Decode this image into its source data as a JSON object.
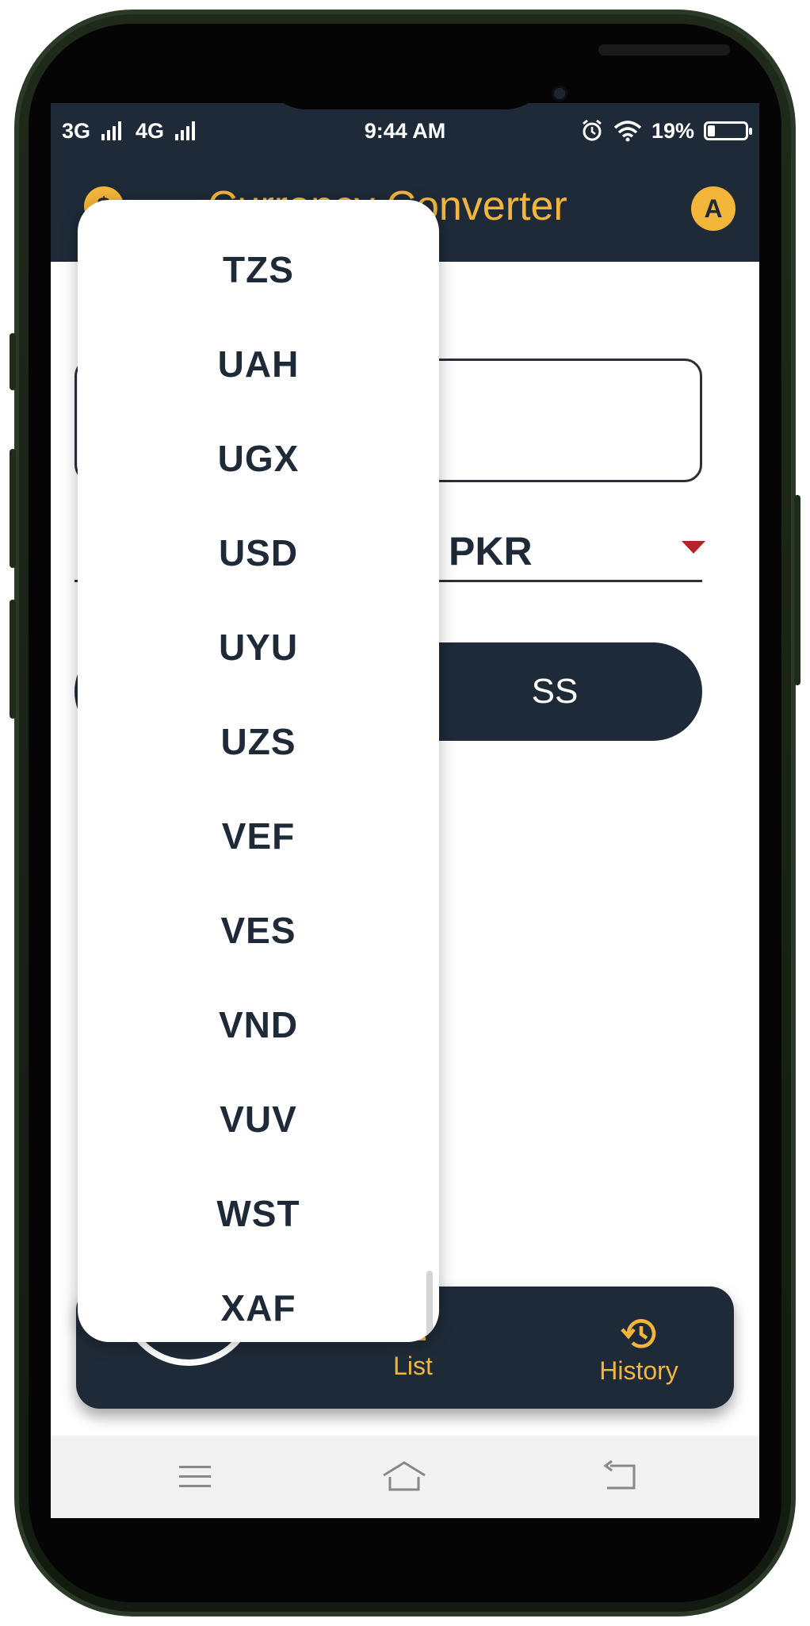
{
  "status_bar": {
    "network_1": "3G",
    "network_2": "4G",
    "time": "9:44 AM",
    "battery_text": "19%",
    "battery_level": 0.19
  },
  "app_bar": {
    "title": "Currency Converter",
    "avatar_letter": "A"
  },
  "converter": {
    "to_currency": "PKR",
    "button_label_partial": "SS"
  },
  "dropdown": {
    "items": [
      "TZS",
      "UAH",
      "UGX",
      "USD",
      "UYU",
      "UZS",
      "VEF",
      "VES",
      "VND",
      "VUV",
      "WST",
      "XAF"
    ]
  },
  "bottom_nav": {
    "list_label": "List",
    "history_label": "History"
  },
  "colors": {
    "primary_dark": "#1f2a38",
    "accent": "#f4b63a",
    "caret_red": "#b4232a"
  },
  "icons": {
    "app_logo": "coin-icon",
    "history": "history-icon",
    "list": "list-icon",
    "menu": "menu-icon",
    "home": "home-icon",
    "back": "back-icon"
  }
}
